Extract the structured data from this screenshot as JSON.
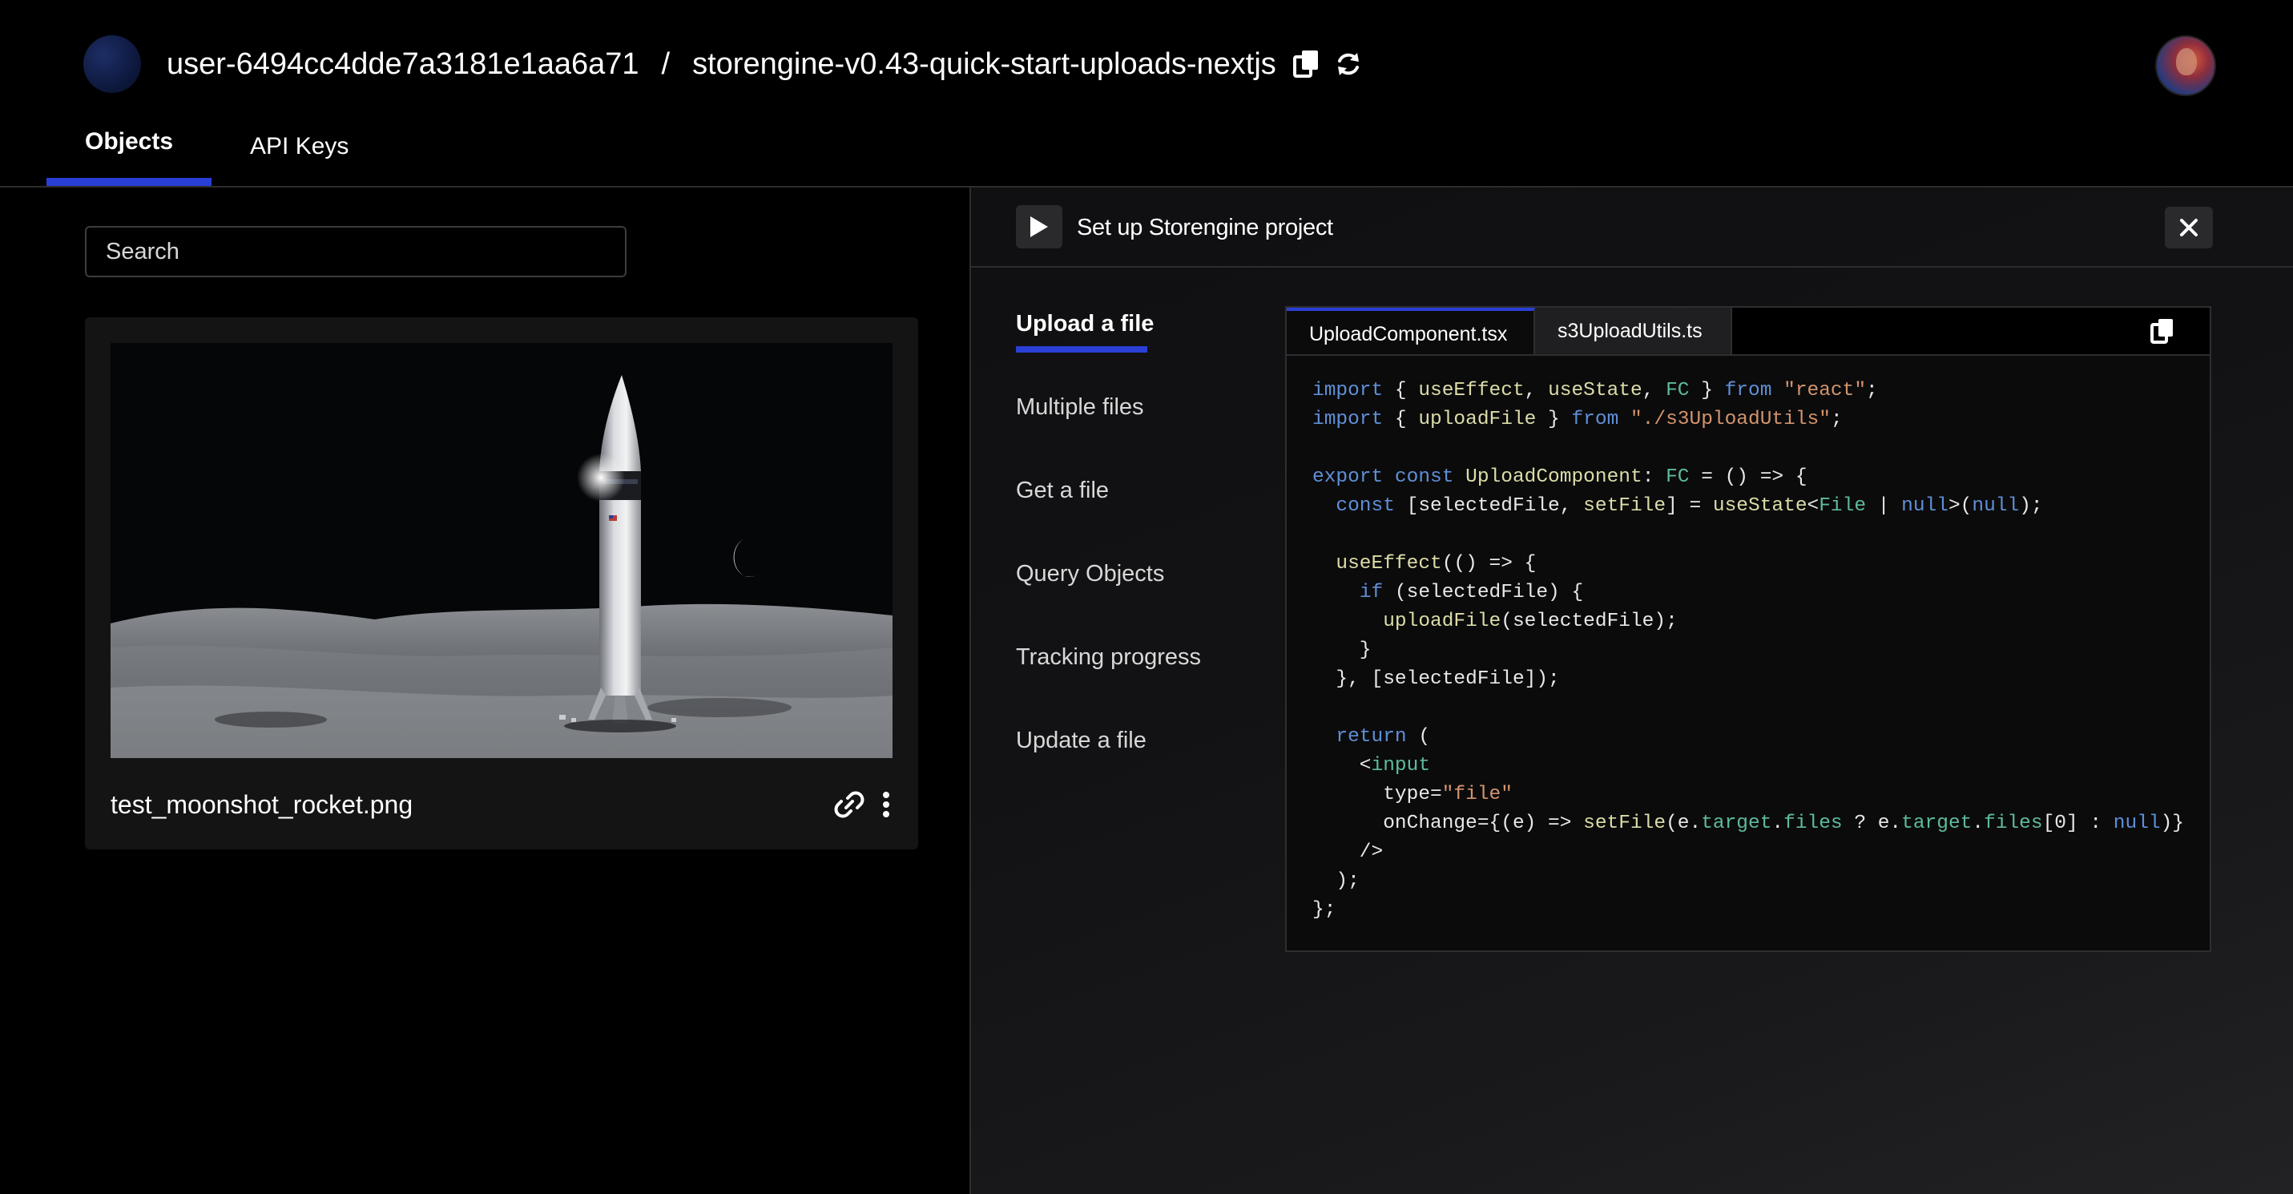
{
  "header": {
    "user": "user-6494cc4dde7a3181e1aa6a71",
    "separator": "/",
    "project": "storengine-v0.43-quick-start-uploads-nextjs",
    "copy_icon": "copy-icon",
    "refresh_icon": "refresh-icon",
    "avatar_icon": "user-avatar"
  },
  "tabs": {
    "objects": "Objects",
    "api_keys": "API Keys"
  },
  "search": {
    "placeholder": "Search"
  },
  "objects": [
    {
      "file_name": "test_moonshot_rocket.png",
      "link_icon": "link-icon",
      "menu_icon": "more-vertical-icon"
    }
  ],
  "panel": {
    "title": "Set up Storengine project",
    "play_icon": "play-icon",
    "close_icon": "close-icon",
    "guides": [
      "Upload a file",
      "Multiple files",
      "Get a file",
      "Query Objects",
      "Tracking progress",
      "Update a file"
    ],
    "active_guide": "Upload a file",
    "code_tabs": [
      "UploadComponent.tsx",
      "s3UploadUtils.ts"
    ],
    "active_code_tab": "UploadComponent.tsx",
    "code_lines": [
      "import { useEffect, useState, FC } from \"react\";",
      "import { uploadFile } from \"./s3UploadUtils\";",
      "",
      "export const UploadComponent: FC = () => {",
      "  const [selectedFile, setFile] = useState<File | null>(null);",
      "",
      "  useEffect(() => {",
      "    if (selectedFile) {",
      "      uploadFile(selectedFile);",
      "    }",
      "  }, [selectedFile]);",
      "",
      "  return (",
      "    <input",
      "      type=\"file\"",
      "      onChange={(e) => setFile(e.target.files ? e.target.files[0] : null)}",
      "    />",
      "  );",
      "};"
    ]
  },
  "colors": {
    "accent": "#2a3fd6",
    "background": "#000000",
    "panel": "#121214",
    "keyword": "#5f8fd6",
    "string": "#d2946d",
    "type": "#5dbb9d"
  }
}
